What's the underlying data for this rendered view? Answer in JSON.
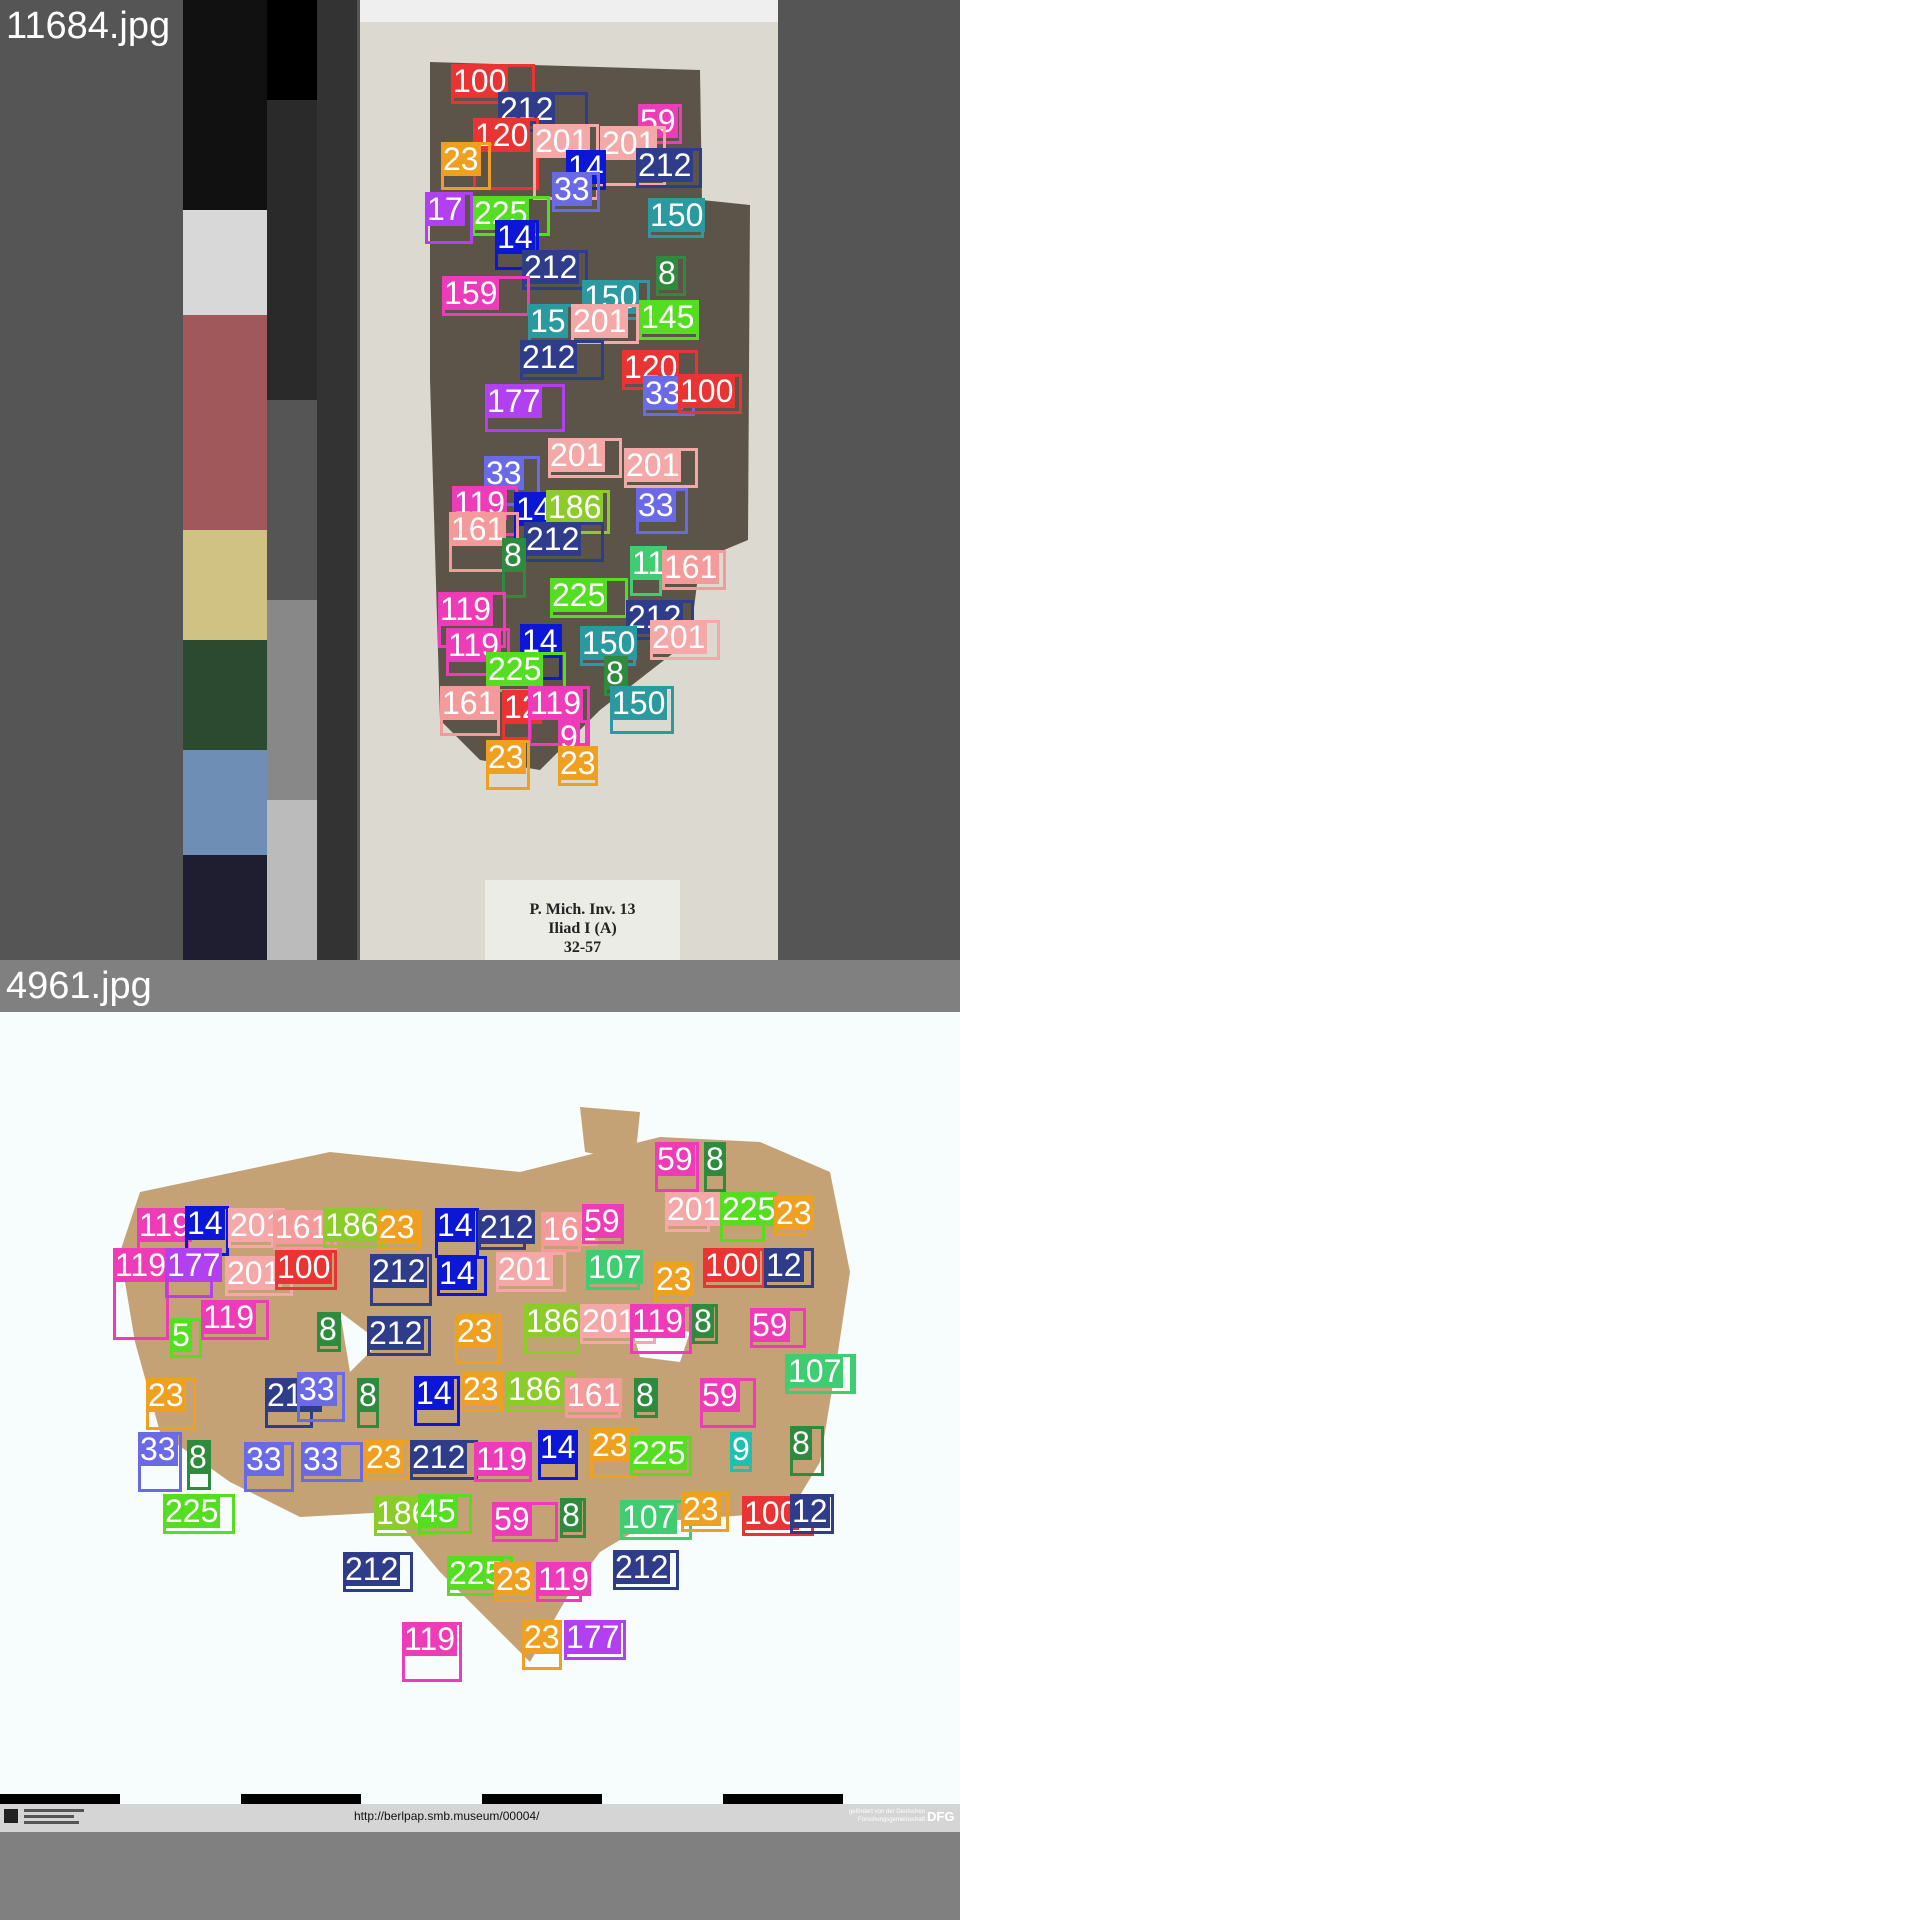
{
  "panels": [
    {
      "filename": "11684.jpg",
      "label_lines": [
        "P. Mich. Inv. 13",
        "Iliad I (A)",
        "32-57"
      ]
    },
    {
      "filename": "4961.jpg",
      "footer_url": "http://berlpap.smb.museum/00004/",
      "footer_credit": "gefördert von der Deutschen Forschungsgemeinschaft",
      "footer_logo": "DFG"
    }
  ],
  "class_colors": {
    "8": "#2e8b3e",
    "9": "#20c0b0",
    "14": "#0b16d6",
    "23": "#f0a020",
    "33": "#6a6ae6",
    "45": "#55dd22",
    "59": "#ee3bb8",
    "100": "#ea3434",
    "107": "#40cc70",
    "119": "#ee3bb8",
    "120": "#ea3434",
    "145": "#55dd22",
    "150": "#2a9aa0",
    "161": "#f59a9a",
    "177": "#b040f0",
    "186": "#8ccc2a",
    "201": "#f5a8a8",
    "212": "#2e3c8a",
    "225": "#55dd22"
  },
  "detections": [
    {
      "boxes": [
        {
          "label": "100",
          "cls": "100"
        },
        {
          "label": "212",
          "cls": "212"
        },
        {
          "label": "59",
          "cls": "59"
        },
        {
          "label": "120",
          "cls": "120"
        },
        {
          "label": "201",
          "cls": "201"
        },
        {
          "label": "201",
          "cls": "201"
        },
        {
          "label": "212",
          "cls": "212"
        },
        {
          "label": "23",
          "cls": "23"
        },
        {
          "label": "14",
          "cls": "14"
        },
        {
          "label": "33",
          "cls": "33"
        },
        {
          "label": "225",
          "cls": "225"
        },
        {
          "label": "17",
          "cls": "177"
        },
        {
          "label": "150",
          "cls": "150"
        },
        {
          "label": "14",
          "cls": "14"
        },
        {
          "label": "212",
          "cls": "212"
        },
        {
          "label": "150",
          "cls": "150"
        },
        {
          "label": "8",
          "cls": "8"
        },
        {
          "label": "159",
          "cls": "119"
        },
        {
          "label": "15",
          "cls": "150"
        },
        {
          "label": "201",
          "cls": "201"
        },
        {
          "label": "145",
          "cls": "145"
        },
        {
          "label": "212",
          "cls": "212"
        },
        {
          "label": "120",
          "cls": "120"
        },
        {
          "label": "33",
          "cls": "33"
        },
        {
          "label": "100",
          "cls": "100"
        },
        {
          "label": "177",
          "cls": "177"
        },
        {
          "label": "201",
          "cls": "201"
        },
        {
          "label": "33",
          "cls": "33"
        },
        {
          "label": "201",
          "cls": "201"
        },
        {
          "label": "119",
          "cls": "119"
        },
        {
          "label": "14",
          "cls": "14"
        },
        {
          "label": "186",
          "cls": "186"
        },
        {
          "label": "33",
          "cls": "33"
        },
        {
          "label": "161",
          "cls": "161"
        },
        {
          "label": "212",
          "cls": "212"
        },
        {
          "label": "8",
          "cls": "8"
        },
        {
          "label": "11",
          "cls": "107"
        },
        {
          "label": "161",
          "cls": "161"
        },
        {
          "label": "225",
          "cls": "225"
        },
        {
          "label": "119",
          "cls": "119"
        },
        {
          "label": "212",
          "cls": "212"
        },
        {
          "label": "119",
          "cls": "119"
        },
        {
          "label": "14",
          "cls": "14"
        },
        {
          "label": "150",
          "cls": "150"
        },
        {
          "label": "201",
          "cls": "201"
        },
        {
          "label": "225",
          "cls": "225"
        },
        {
          "label": "8",
          "cls": "8"
        },
        {
          "label": "161",
          "cls": "161"
        },
        {
          "label": "12",
          "cls": "120"
        },
        {
          "label": "119",
          "cls": "119"
        },
        {
          "label": "150",
          "cls": "150"
        },
        {
          "label": "9",
          "cls": "59"
        },
        {
          "label": "23",
          "cls": "23"
        },
        {
          "label": "23",
          "cls": "23"
        }
      ]
    },
    {
      "boxes": [
        {
          "label": "59",
          "cls": "59"
        },
        {
          "label": "8",
          "cls": "8"
        },
        {
          "label": "201",
          "cls": "201"
        },
        {
          "label": "225",
          "cls": "225"
        },
        {
          "label": "23",
          "cls": "23"
        },
        {
          "label": "119",
          "cls": "119"
        },
        {
          "label": "14",
          "cls": "14"
        },
        {
          "label": "201",
          "cls": "201"
        },
        {
          "label": "161",
          "cls": "161"
        },
        {
          "label": "186",
          "cls": "186"
        },
        {
          "label": "23",
          "cls": "23"
        },
        {
          "label": "14",
          "cls": "14"
        },
        {
          "label": "212",
          "cls": "212"
        },
        {
          "label": "161",
          "cls": "161"
        },
        {
          "label": "59",
          "cls": "59"
        },
        {
          "label": "119",
          "cls": "119"
        },
        {
          "label": "177",
          "cls": "177"
        },
        {
          "label": "201",
          "cls": "201"
        },
        {
          "label": "100",
          "cls": "100"
        },
        {
          "label": "212",
          "cls": "212"
        },
        {
          "label": "14",
          "cls": "14"
        },
        {
          "label": "201",
          "cls": "201"
        },
        {
          "label": "107",
          "cls": "107"
        },
        {
          "label": "23",
          "cls": "23"
        },
        {
          "label": "100",
          "cls": "100"
        },
        {
          "label": "12",
          "cls": "212"
        },
        {
          "label": "5",
          "cls": "45"
        },
        {
          "label": "119",
          "cls": "119"
        },
        {
          "label": "8",
          "cls": "8"
        },
        {
          "label": "212",
          "cls": "212"
        },
        {
          "label": "23",
          "cls": "23"
        },
        {
          "label": "186",
          "cls": "186"
        },
        {
          "label": "201",
          "cls": "201"
        },
        {
          "label": "119",
          "cls": "119"
        },
        {
          "label": "8",
          "cls": "8"
        },
        {
          "label": "59",
          "cls": "59"
        },
        {
          "label": "107",
          "cls": "107"
        },
        {
          "label": "23",
          "cls": "23"
        },
        {
          "label": "212",
          "cls": "212"
        },
        {
          "label": "33",
          "cls": "33"
        },
        {
          "label": "8",
          "cls": "8"
        },
        {
          "label": "14",
          "cls": "14"
        },
        {
          "label": "23",
          "cls": "23"
        },
        {
          "label": "186",
          "cls": "186"
        },
        {
          "label": "161",
          "cls": "161"
        },
        {
          "label": "8",
          "cls": "8"
        },
        {
          "label": "59",
          "cls": "59"
        },
        {
          "label": "107",
          "cls": "107"
        },
        {
          "label": "33",
          "cls": "33"
        },
        {
          "label": "8",
          "cls": "8"
        },
        {
          "label": "33",
          "cls": "33"
        },
        {
          "label": "33",
          "cls": "33"
        },
        {
          "label": "23",
          "cls": "23"
        },
        {
          "label": "212",
          "cls": "212"
        },
        {
          "label": "119",
          "cls": "119"
        },
        {
          "label": "14",
          "cls": "14"
        },
        {
          "label": "23",
          "cls": "23"
        },
        {
          "label": "225",
          "cls": "225"
        },
        {
          "label": "9",
          "cls": "9"
        },
        {
          "label": "8",
          "cls": "8"
        },
        {
          "label": "225",
          "cls": "225"
        },
        {
          "label": "186",
          "cls": "186"
        },
        {
          "label": "45",
          "cls": "45"
        },
        {
          "label": "59",
          "cls": "59"
        },
        {
          "label": "8",
          "cls": "8"
        },
        {
          "label": "107",
          "cls": "107"
        },
        {
          "label": "23",
          "cls": "23"
        },
        {
          "label": "100",
          "cls": "100"
        },
        {
          "label": "12",
          "cls": "212"
        },
        {
          "label": "212",
          "cls": "212"
        },
        {
          "label": "225",
          "cls": "225"
        },
        {
          "label": "23",
          "cls": "23"
        },
        {
          "label": "119",
          "cls": "119"
        },
        {
          "label": "212",
          "cls": "212"
        },
        {
          "label": "119",
          "cls": "119"
        },
        {
          "label": "23",
          "cls": "23"
        },
        {
          "label": "177",
          "cls": "177"
        }
      ]
    }
  ]
}
